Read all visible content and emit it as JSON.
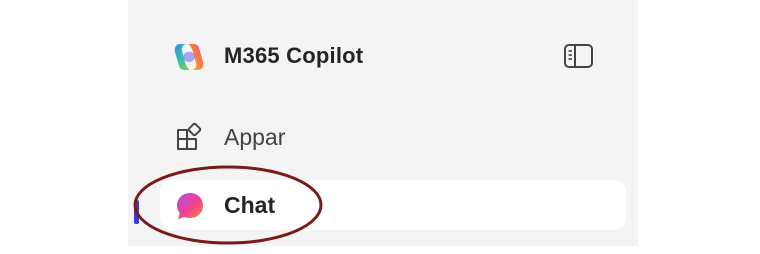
{
  "header": {
    "title": "M365 Copilot",
    "logo_icon": "copilot-logo-icon",
    "toggle_icon": "sidebar-toggle-icon"
  },
  "nav": {
    "items": [
      {
        "label": "Appar",
        "icon": "apps-icon",
        "active": false
      },
      {
        "label": "Chat",
        "icon": "chat-bubble-icon",
        "active": true
      }
    ]
  },
  "colors": {
    "panel_background": "#f4f4f4",
    "active_item_background": "#ffffff",
    "active_indicator": "#3b3bd6",
    "highlight_annotation": "#7a1a1a",
    "text_primary": "#242424",
    "text_secondary": "#424242"
  }
}
